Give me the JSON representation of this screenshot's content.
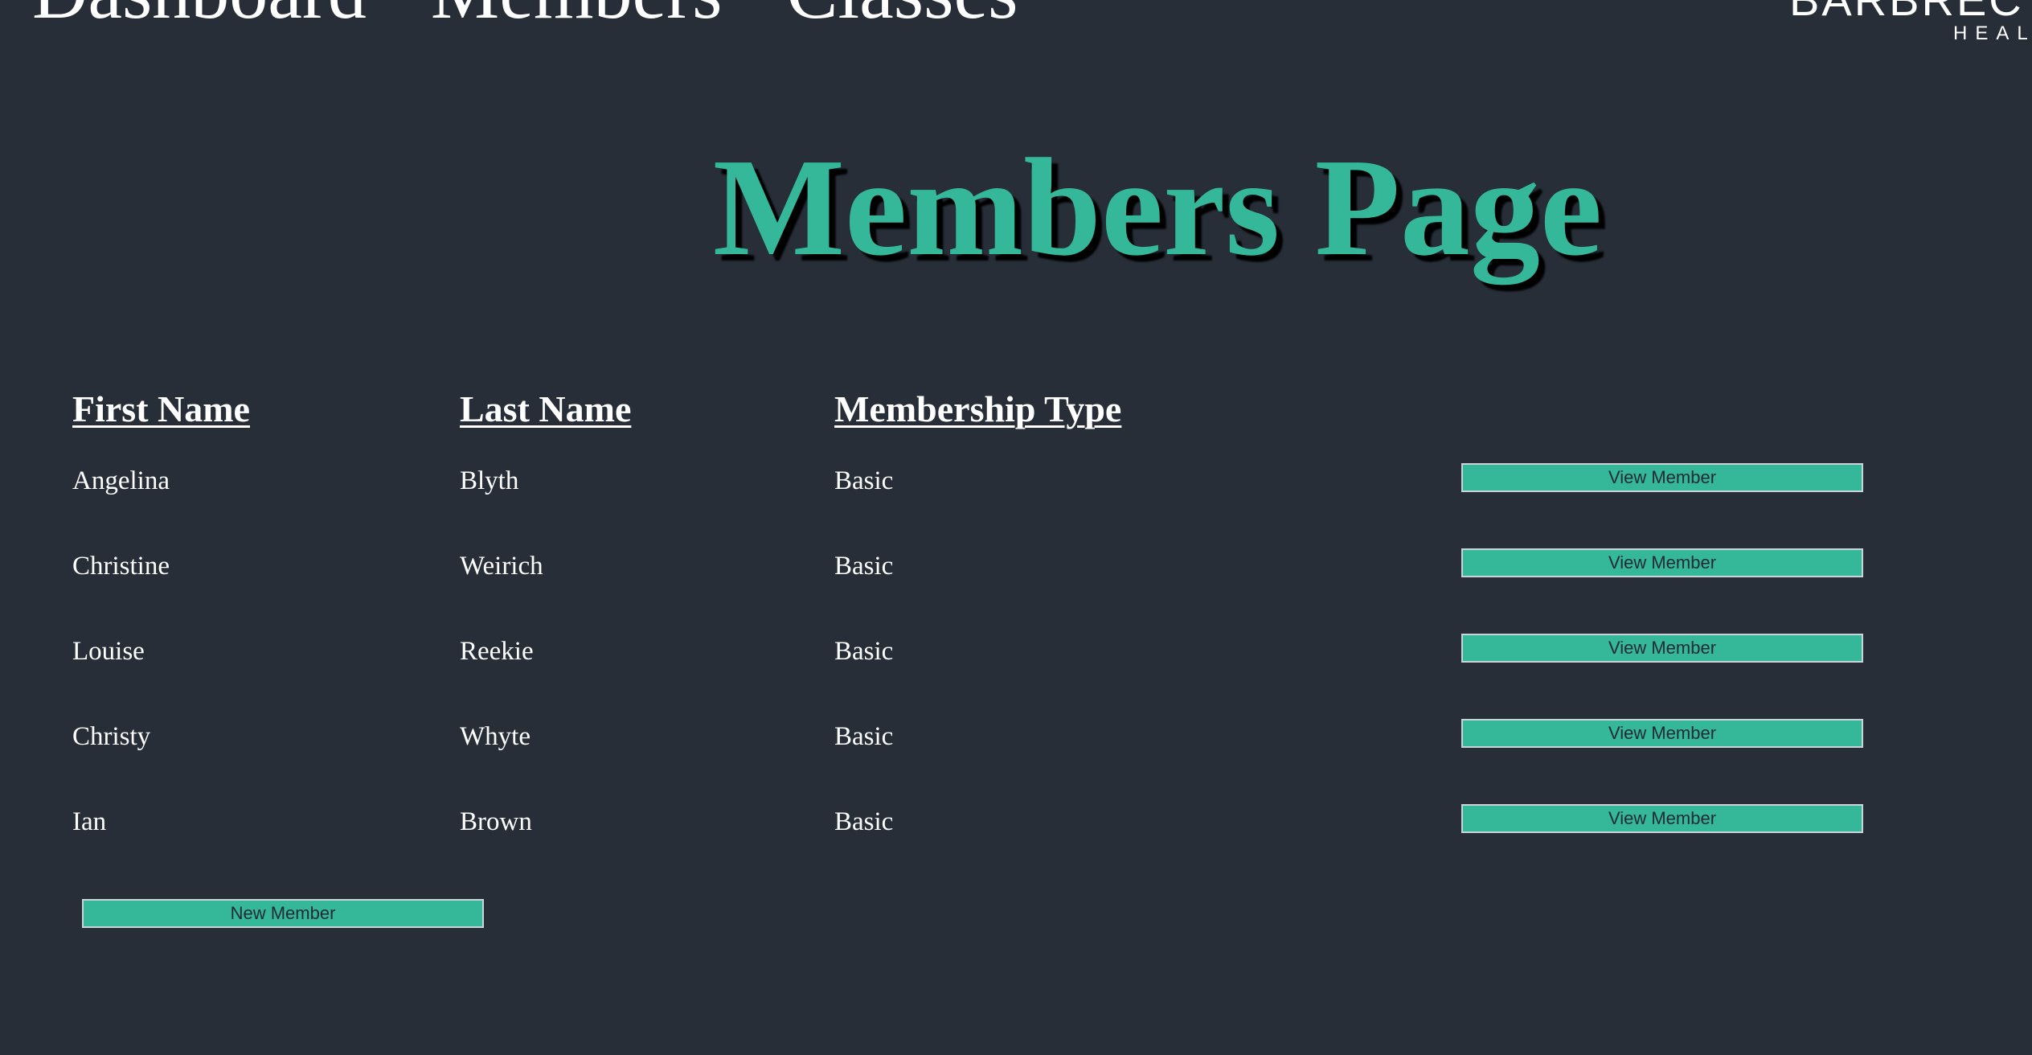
{
  "nav": {
    "items": [
      "Dashboard",
      "Members",
      "Classes"
    ]
  },
  "logo": {
    "main": "BARBREC",
    "sub": "HEAL"
  },
  "page": {
    "title": "Members Page"
  },
  "table": {
    "headers": {
      "first_name": "First Name",
      "last_name": "Last Name",
      "membership_type": "Membership Type"
    },
    "rows": [
      {
        "first_name": "Angelina",
        "last_name": "Blyth",
        "membership_type": "Basic",
        "action": "View Member"
      },
      {
        "first_name": "Christine",
        "last_name": "Weirich",
        "membership_type": "Basic",
        "action": "View Member"
      },
      {
        "first_name": "Louise",
        "last_name": "Reekie",
        "membership_type": "Basic",
        "action": "View Member"
      },
      {
        "first_name": "Christy",
        "last_name": "Whyte",
        "membership_type": "Basic",
        "action": "View Member"
      },
      {
        "first_name": "Ian",
        "last_name": "Brown",
        "membership_type": "Basic",
        "action": "View Member"
      }
    ]
  },
  "actions": {
    "new_member": "New Member"
  },
  "colors": {
    "background": "#272e38",
    "accent": "#35b89a",
    "text": "#ffffff"
  }
}
